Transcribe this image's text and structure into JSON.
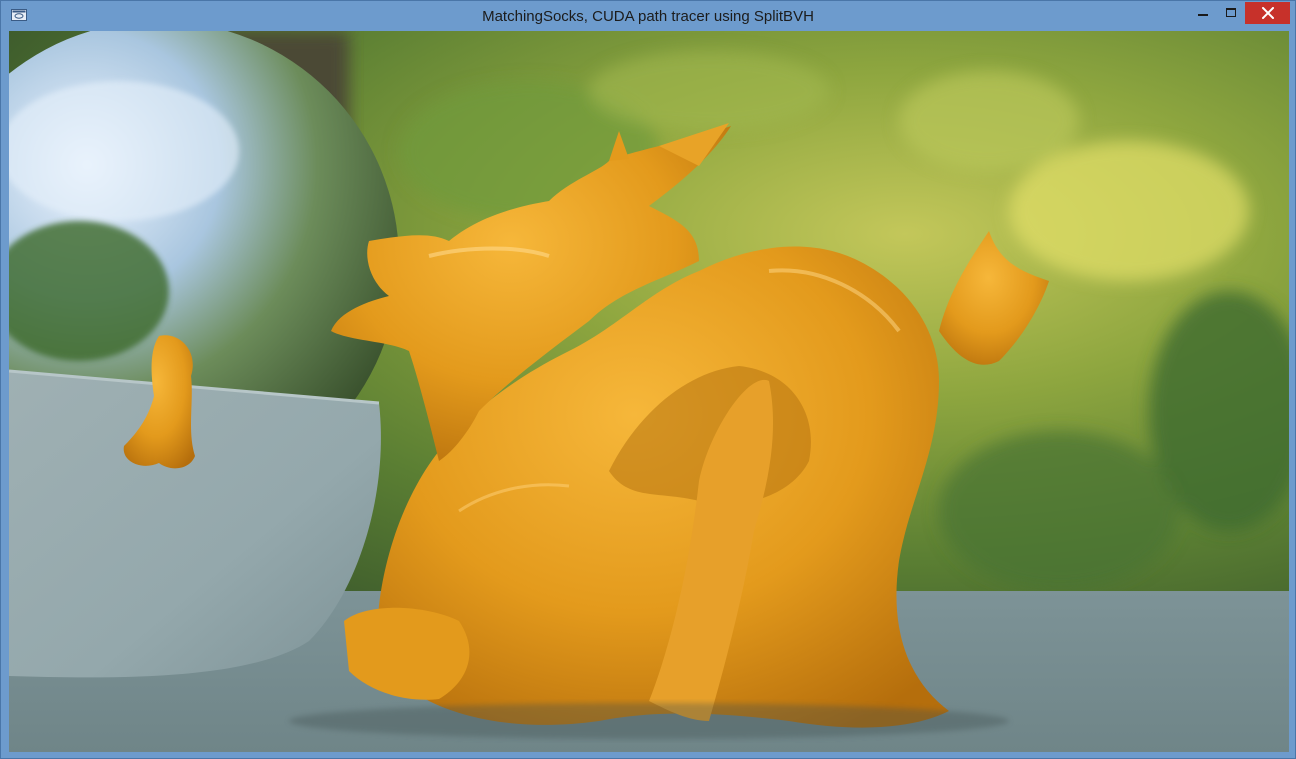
{
  "window": {
    "title": "MatchingSocks, CUDA path tracer using SplitBVH",
    "app_icon": "app-window-icon",
    "controls": {
      "minimize_icon": "minimize-icon",
      "maximize_icon": "maximize-icon",
      "close_icon": "close-icon"
    }
  },
  "render": {
    "description_icon": "render-viewport",
    "colors": {
      "dragon": "#e39a1c",
      "bowl": "#9fb2b6",
      "floor": "#7f9597",
      "foliage": "#8aa842"
    }
  }
}
